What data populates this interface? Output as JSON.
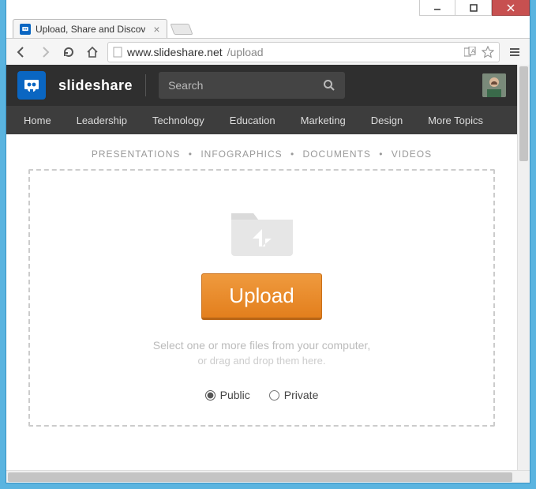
{
  "window": {
    "tab_title": "Upload, Share and Discov",
    "url_host": "www.slideshare.net",
    "url_path": "/upload"
  },
  "header": {
    "brand": "slideshare",
    "search_placeholder": "Search"
  },
  "nav": {
    "items": [
      "Home",
      "Leadership",
      "Technology",
      "Education",
      "Marketing",
      "Design",
      "More Topics"
    ]
  },
  "upload_types": {
    "items": [
      "PRESENTATIONS",
      "INFOGRAPHICS",
      "DOCUMENTS",
      "VIDEOS"
    ],
    "separator": "•"
  },
  "dropzone": {
    "button_label": "Upload",
    "help_line1": "Select one or more files from your computer,",
    "help_line2": "or drag and drop them here."
  },
  "visibility": {
    "public_label": "Public",
    "private_label": "Private",
    "selected": "public"
  }
}
